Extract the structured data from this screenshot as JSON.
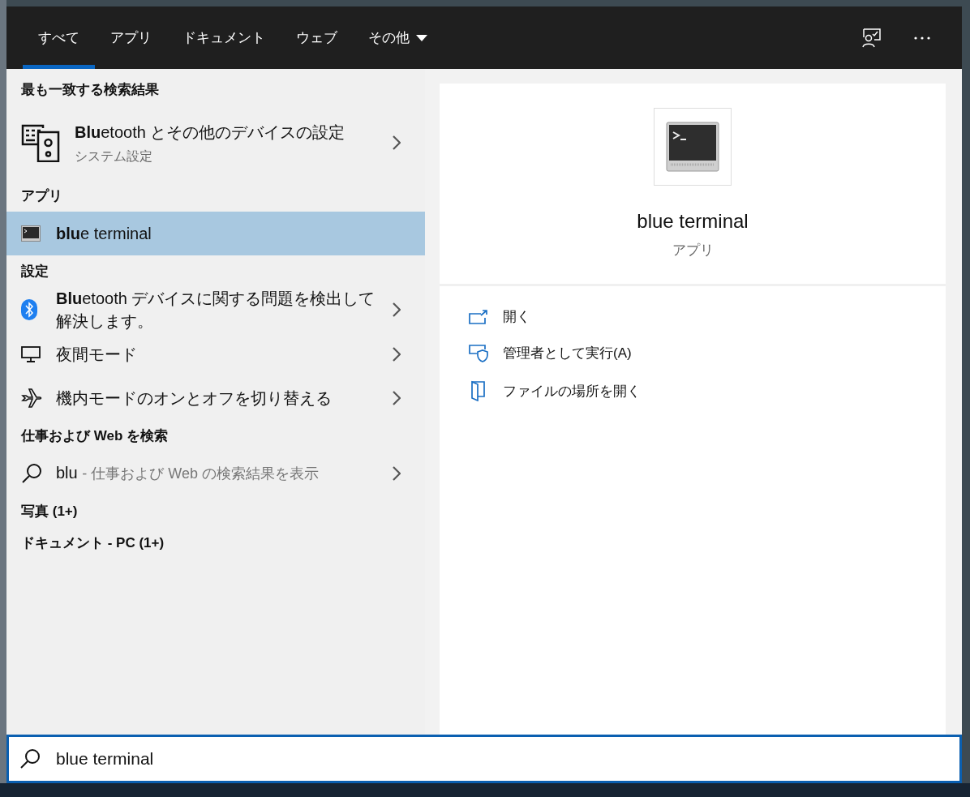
{
  "tabs": [
    {
      "label": "すべて",
      "selected": true,
      "kind": "plain"
    },
    {
      "label": "アプリ",
      "selected": false,
      "kind": "plain"
    },
    {
      "label": "ドキュメント",
      "selected": false,
      "kind": "plain"
    },
    {
      "label": "ウェブ",
      "selected": false,
      "kind": "plain"
    },
    {
      "label": "その他",
      "selected": false,
      "kind": "dropdown"
    }
  ],
  "sections": [
    {
      "title": "最も一致する検索結果",
      "items": [
        {
          "kind": "best",
          "title": "**Blu**etooth とその他のデバイスの設定",
          "subtitle": "システム設定",
          "selected": false
        }
      ]
    },
    {
      "title": "アプリ",
      "items": [
        {
          "kind": "app",
          "title": "**blu**e terminal",
          "selected": true
        }
      ]
    },
    {
      "title": "設定",
      "items": [
        {
          "kind": "setting",
          "title": "**Blu**etooth デバイスに関する問題を検出して解決します。",
          "selected": false
        },
        {
          "kind": "setting",
          "title": "夜間モード",
          "selected": false
        },
        {
          "kind": "setting",
          "title": "機内モードのオンとオフを切り替える",
          "selected": false
        }
      ]
    },
    {
      "title": "仕事および Web を検索",
      "items": [
        {
          "kind": "web",
          "query": "blu",
          "hint": "- 仕事および Web の検索結果を表示",
          "selected": false
        }
      ]
    },
    {
      "title": "写真 (1+)"
    },
    {
      "title": "ドキュメント - PC (1+)"
    }
  ],
  "preview": {
    "title": "blue terminal",
    "subtitle": "アプリ",
    "actions": [
      "開く",
      "管理者として実行(A)",
      "ファイルの場所を開く"
    ]
  },
  "search": {
    "value": "blue terminal"
  }
}
